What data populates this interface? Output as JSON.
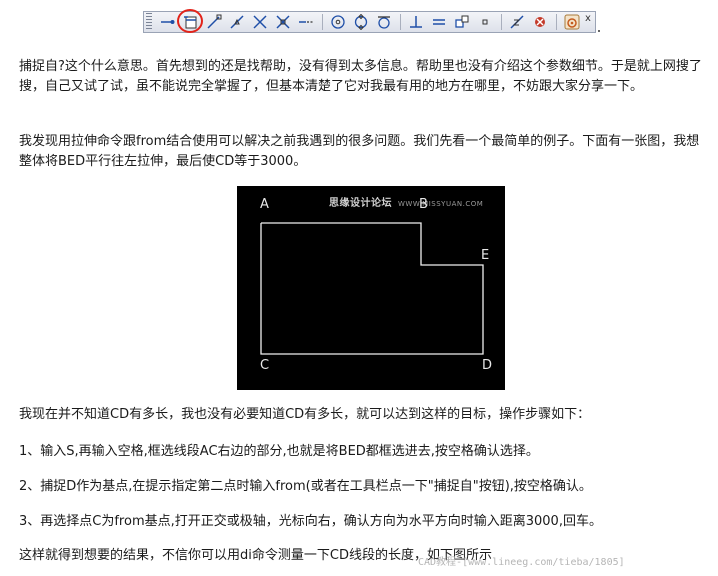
{
  "toolbar": {
    "buttons": [
      {
        "name": "temp-track-point-icon"
      },
      {
        "name": "snap-from-icon",
        "highlighted": true
      },
      {
        "name": "snap-endpoint-icon"
      },
      {
        "name": "snap-midpoint-icon"
      },
      {
        "name": "snap-intersection-icon"
      },
      {
        "name": "snap-apparent-intersection-icon"
      },
      {
        "name": "snap-extension-icon"
      },
      {
        "name": "snap-center-icon"
      },
      {
        "name": "snap-quadrant-icon"
      },
      {
        "name": "snap-tangent-icon"
      },
      {
        "name": "snap-perpendicular-icon"
      },
      {
        "name": "snap-parallel-icon"
      },
      {
        "name": "snap-insert-icon"
      },
      {
        "name": "snap-node-icon"
      },
      {
        "name": "snap-nearest-icon"
      },
      {
        "name": "snap-none-icon"
      },
      {
        "name": "osnap-settings-icon"
      }
    ],
    "close_label": "x",
    "highlight_color": "#e2231a"
  },
  "article": {
    "p1": "捕捉自?这个什么意思。首先想到的还是找帮助，没有得到太多信息。帮助里也没有介绍这个参数细节。于是就上网搜了搜，自己又试了试，虽不能说完全掌握了，但基本清楚了它对我最有用的地方在哪里，不妨跟大家分享一下。",
    "p2": "我发现用拉伸命令跟from结合使用可以解决之前我遇到的很多问题。我们先看一个最简单的例子。下面有一张图，我想整体将BED平行往左拉伸，最后使CD等于3000。",
    "p3": "我现在并不知道CD有多长，我也没有必要知道CD有多长，就可以达到这样的目标，操作步骤如下：",
    "p4": "1、输入S,再输入空格,框选线段AC右边的部分,也就是将BED都框选进去,按空格确认选择。",
    "p5": "2、捕捉D作为基点,在提示指定第二点时输入from(或者在工具栏点一下\"捕捉自\"按钮),按空格确认。",
    "p6": "3、再选择点C为from基点,打开正交或极轴，光标向右，确认方向为水平方向时输入距离3000,回车。",
    "p7": "这样就得到想要的结果，不信你可以用di命令测量一下CD线段的长度，如下图所示"
  },
  "figure": {
    "labels": {
      "a": "A",
      "b": "B",
      "c": "C",
      "d": "D",
      "e": "E"
    },
    "watermark": "思缘设计论坛",
    "watermark_sub": "WWW.MISSYUAN.COM",
    "background": "#000000",
    "line_color": "#f0f0f0"
  },
  "watermark": "CAD教程-[www.lineeg.com/tieba/1805]"
}
